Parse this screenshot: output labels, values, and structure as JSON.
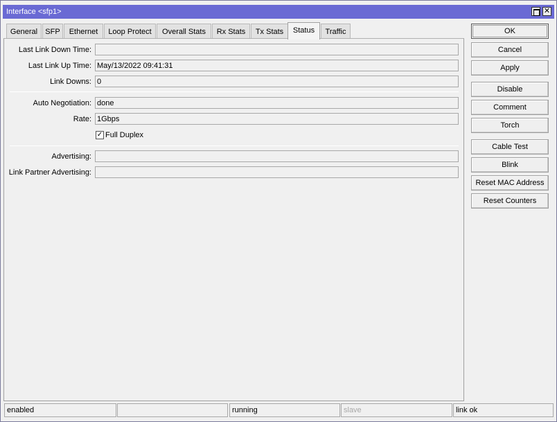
{
  "window": {
    "title": "Interface <sfp1>"
  },
  "tabs": [
    {
      "label": "General"
    },
    {
      "label": "SFP"
    },
    {
      "label": "Ethernet"
    },
    {
      "label": "Loop Protect"
    },
    {
      "label": "Overall Stats"
    },
    {
      "label": "Rx Stats"
    },
    {
      "label": "Tx Stats"
    },
    {
      "label": "Status",
      "active": true
    },
    {
      "label": "Traffic"
    }
  ],
  "status": {
    "last_link_down_time": {
      "label": "Last Link Down Time:",
      "value": ""
    },
    "last_link_up_time": {
      "label": "Last Link Up Time:",
      "value": "May/13/2022 09:41:31"
    },
    "link_downs": {
      "label": "Link Downs:",
      "value": "0"
    },
    "auto_negotiation": {
      "label": "Auto Negotiation:",
      "value": "done"
    },
    "rate": {
      "label": "Rate:",
      "value": "1Gbps"
    },
    "full_duplex": {
      "label": "Full Duplex",
      "checked": true,
      "mark": "✓"
    },
    "advertising": {
      "label": "Advertising:",
      "value": ""
    },
    "link_partner_advertising": {
      "label": "Link Partner Advertising:",
      "value": ""
    }
  },
  "buttons": {
    "ok": "OK",
    "cancel": "Cancel",
    "apply": "Apply",
    "disable": "Disable",
    "comment": "Comment",
    "torch": "Torch",
    "cable_test": "Cable Test",
    "blink": "Blink",
    "reset_mac": "Reset MAC Address",
    "reset_counters": "Reset Counters"
  },
  "statusbar": {
    "state": "enabled",
    "empty": "",
    "running": "running",
    "slave": "slave",
    "link": "link ok"
  },
  "icons": {
    "maximize": "maximize-icon",
    "close": "close-icon",
    "close_glyph": "✕"
  }
}
